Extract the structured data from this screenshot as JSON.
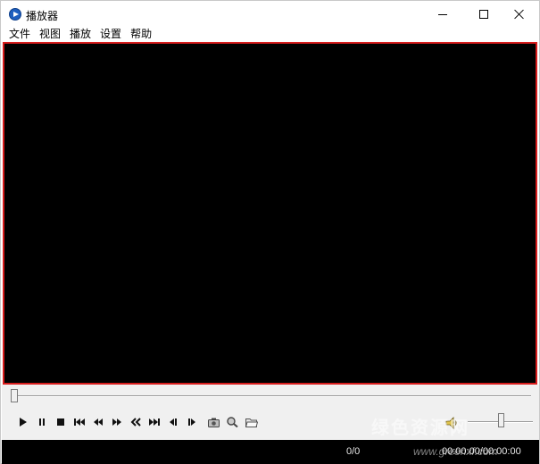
{
  "window": {
    "title": "播放器",
    "icon": "player-app-icon"
  },
  "menu": {
    "items": [
      {
        "label": "文件"
      },
      {
        "label": "视图"
      },
      {
        "label": "播放"
      },
      {
        "label": "设置"
      },
      {
        "label": "帮助"
      }
    ]
  },
  "video": {
    "border_color": "#d81d1d",
    "background": "#000000"
  },
  "seek": {
    "position": 0
  },
  "controls": [
    {
      "name": "play-icon"
    },
    {
      "name": "pause-icon"
    },
    {
      "name": "stop-icon"
    },
    {
      "name": "previous-icon"
    },
    {
      "name": "rewind-icon"
    },
    {
      "name": "fast-forward-icon"
    },
    {
      "name": "slow-down-icon"
    },
    {
      "name": "next-icon"
    },
    {
      "name": "step-back-frame-icon"
    },
    {
      "name": "step-forward-frame-icon"
    },
    {
      "name": "screenshot-icon"
    },
    {
      "name": "zoom-icon"
    },
    {
      "name": "open-folder-icon"
    }
  ],
  "volume": {
    "icon": "speaker-icon",
    "level": 0.6
  },
  "status": {
    "count": "0/0",
    "time": "00:00:00/00:00:00"
  },
  "watermark": {
    "text": "绿色资源网",
    "url": "www.greenxf.com"
  }
}
